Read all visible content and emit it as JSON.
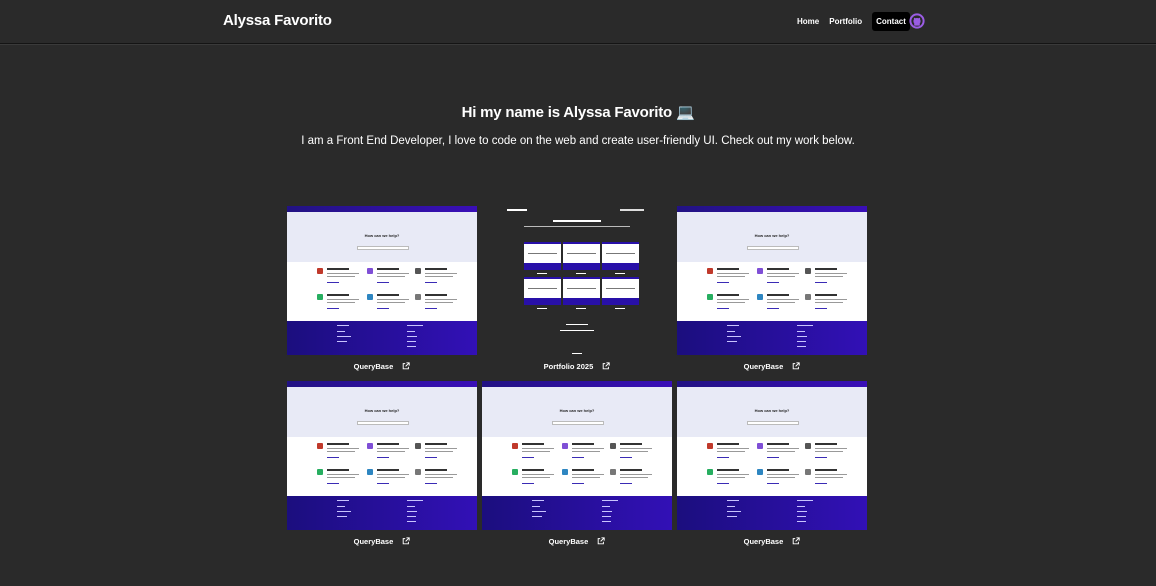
{
  "navbar": {
    "brand": "Alyssa Favorito",
    "links": {
      "home": "Home",
      "portfolio": "Portfolio",
      "contact": "Contact"
    },
    "github_icon": "github-icon"
  },
  "hero": {
    "title": "Hi my name is Alyssa Favorito 💻",
    "subtitle": "I am a Front End Developer, I love to code on the web and create user-friendly UI. Check out my work below."
  },
  "projects": [
    {
      "title": "QueryBase",
      "thumbnail": "querybase"
    },
    {
      "title": "Portfolio 2025",
      "thumbnail": "portfolio"
    },
    {
      "title": "QueryBase",
      "thumbnail": "querybase"
    },
    {
      "title": "QueryBase",
      "thumbnail": "querybase"
    },
    {
      "title": "QueryBase",
      "thumbnail": "querybase"
    },
    {
      "title": "QueryBase",
      "thumbnail": "querybase"
    }
  ],
  "colors": {
    "background": "#2a2a2a",
    "accent": "#9b5de5",
    "querybase_footer": "#2a10a8"
  }
}
